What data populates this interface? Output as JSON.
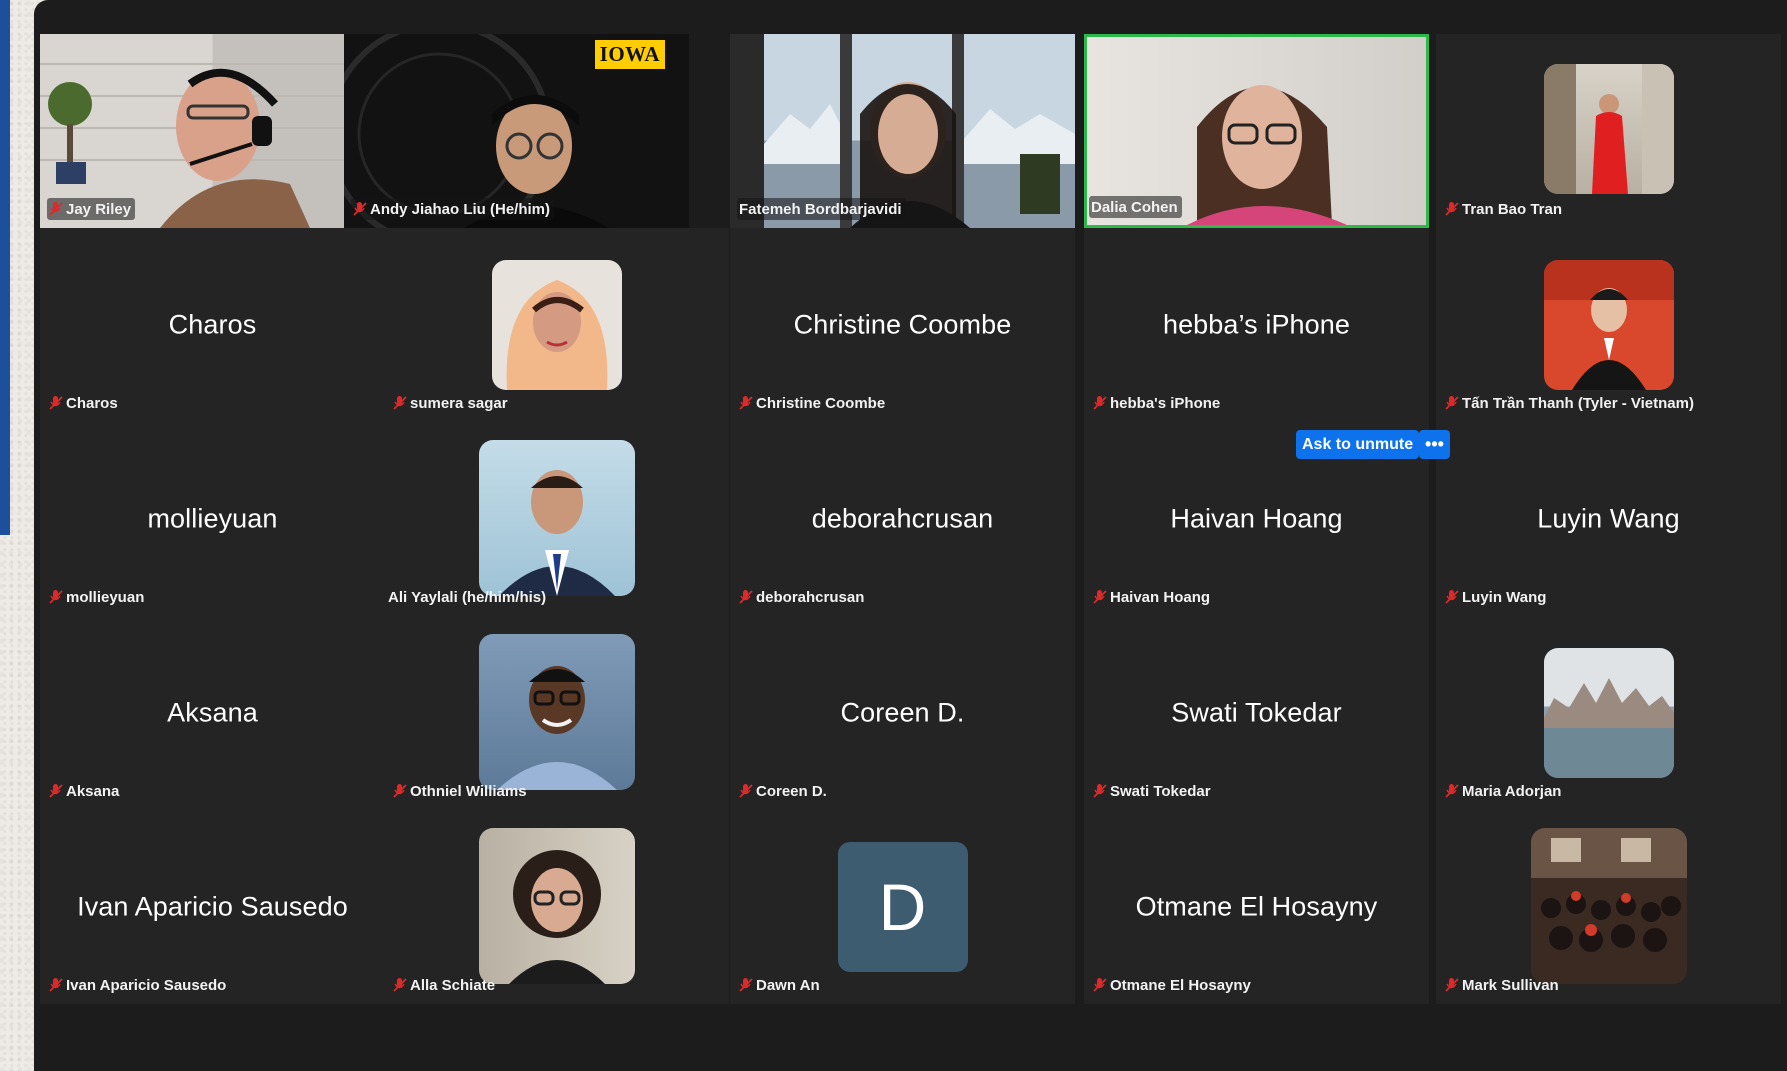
{
  "participants": [
    {
      "name": "Jay Riley",
      "muted": true
    },
    {
      "name": "Andy Jiahao Liu (He/him)",
      "muted": true
    },
    {
      "name": "Fatemeh Bordbarjavidi",
      "muted": false
    },
    {
      "name": "Dalia Cohen",
      "muted": false,
      "active_speaker": true
    },
    {
      "name": "Tran Bao Tran",
      "muted": true
    },
    {
      "name": "Charos",
      "display": "Charos",
      "muted": true
    },
    {
      "name": "sumera sagar",
      "muted": true
    },
    {
      "name": "Christine Coombe",
      "display": "Christine Coombe",
      "muted": true
    },
    {
      "name": "hebba's iPhone",
      "display": "hebba’s iPhone",
      "muted": true
    },
    {
      "name": "Tấn Trần Thanh (Tyler - Vietnam)",
      "muted": true
    },
    {
      "name": "mollieyuan",
      "display": "mollieyuan",
      "muted": true
    },
    {
      "name": "Ali Yaylali (he/him/his)",
      "muted": false
    },
    {
      "name": "deborahcrusan",
      "display": "deborahcrusan",
      "muted": true
    },
    {
      "name": "Haivan Hoang",
      "display": "Haivan Hoang",
      "muted": true
    },
    {
      "name": "Luyin Wang",
      "display": "Luyin Wang",
      "muted": true
    },
    {
      "name": "Aksana",
      "display": "Aksana",
      "muted": true
    },
    {
      "name": "Othniel Williams",
      "muted": true
    },
    {
      "name": "Coreen D.",
      "display": "Coreen D.",
      "muted": true
    },
    {
      "name": "Swati Tokedar",
      "display": "Swati Tokedar",
      "muted": true
    },
    {
      "name": "Maria Adorjan",
      "muted": true
    },
    {
      "name": "Ivan Aparicio Sausedo",
      "display": "Ivan Aparicio Sausedo",
      "muted": true
    },
    {
      "name": "Alla Schiate",
      "muted": true
    },
    {
      "name": "Dawn An",
      "avatar_letter": "D",
      "muted": true
    },
    {
      "name": "Otmane El Hosayny",
      "display": "Otmane El Hosayny",
      "muted": true
    },
    {
      "name": "Mark Sullivan",
      "muted": true
    }
  ],
  "logo": {
    "text": "IOWA"
  },
  "hover_controls": {
    "ask_to_unmute": "Ask to unmute",
    "more": "•••"
  },
  "colors": {
    "window_bg": "#1c1c1c",
    "tile_bg": "#242424",
    "active_border": "#2db84a",
    "muted_mic": "#e02828",
    "button_blue": "#0e72ed",
    "avatar_bg": "#3e5c70",
    "logo_yellow": "#ffcd00"
  },
  "icons": {
    "muted": "mic-muted-icon",
    "more": "more-options-icon"
  }
}
